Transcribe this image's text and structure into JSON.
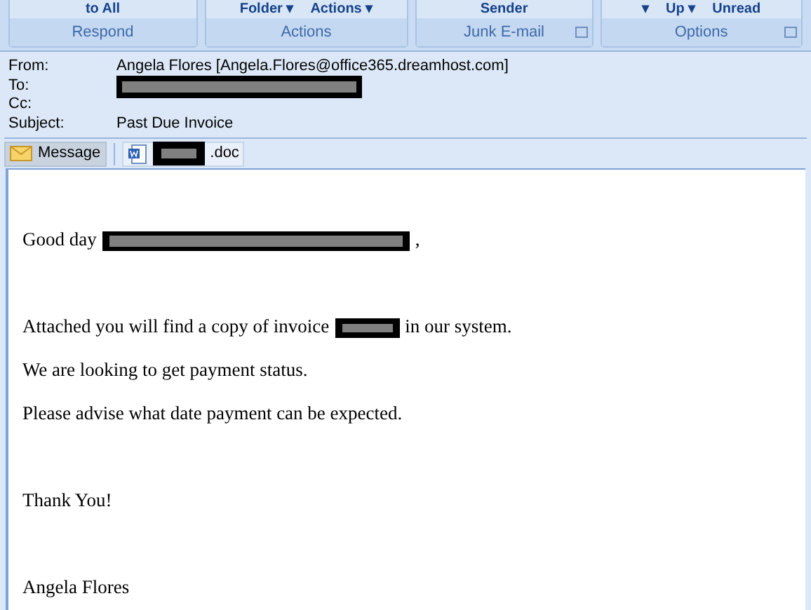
{
  "ribbon": {
    "groups": [
      {
        "label": "Respond",
        "buttons": [
          "to All"
        ]
      },
      {
        "label": "Actions",
        "buttons": [
          "Folder ▾",
          "Actions ▾"
        ]
      },
      {
        "label": "Junk E-mail",
        "buttons": [
          "Sender"
        ],
        "launcher": true
      },
      {
        "label": "Options",
        "buttons": [
          "▾",
          "Up ▾",
          "Unread"
        ],
        "launcher": true
      }
    ]
  },
  "header": [
    {
      "label": "From:",
      "value": "Angela Flores [Angela.Flores@office365.dreamhost.com]"
    },
    {
      "label": "To:",
      "redacted": true
    },
    {
      "label": "Cc:"
    },
    {
      "label": "Subject:",
      "value": "Past Due Invoice"
    }
  ],
  "attachments": [
    {
      "kind": "message",
      "label": "Message",
      "selected": true
    },
    {
      "kind": "document",
      "label": ".doc",
      "redacted": true,
      "selected": false
    }
  ],
  "body": {
    "blocks": [
      [
        [
          {
            "kind": "text",
            "text": "Good day"
          },
          {
            "kind": "redaction"
          },
          {
            "kind": "text",
            "text": ","
          }
        ]
      ],
      [
        [
          {
            "kind": "text",
            "text": "Attached you will find a copy of invoice"
          },
          {
            "kind": "redaction"
          },
          {
            "kind": "text",
            "text": "in our system."
          }
        ],
        [
          {
            "kind": "text",
            "text": "We are looking to get payment status."
          }
        ],
        [
          {
            "kind": "text",
            "text": "Please advise what date payment can be expected."
          }
        ]
      ],
      [
        [
          {
            "kind": "text",
            "text": "Thank You!"
          }
        ]
      ],
      [
        [
          {
            "kind": "text",
            "text": "Angela Flores"
          }
        ]
      ]
    ]
  }
}
